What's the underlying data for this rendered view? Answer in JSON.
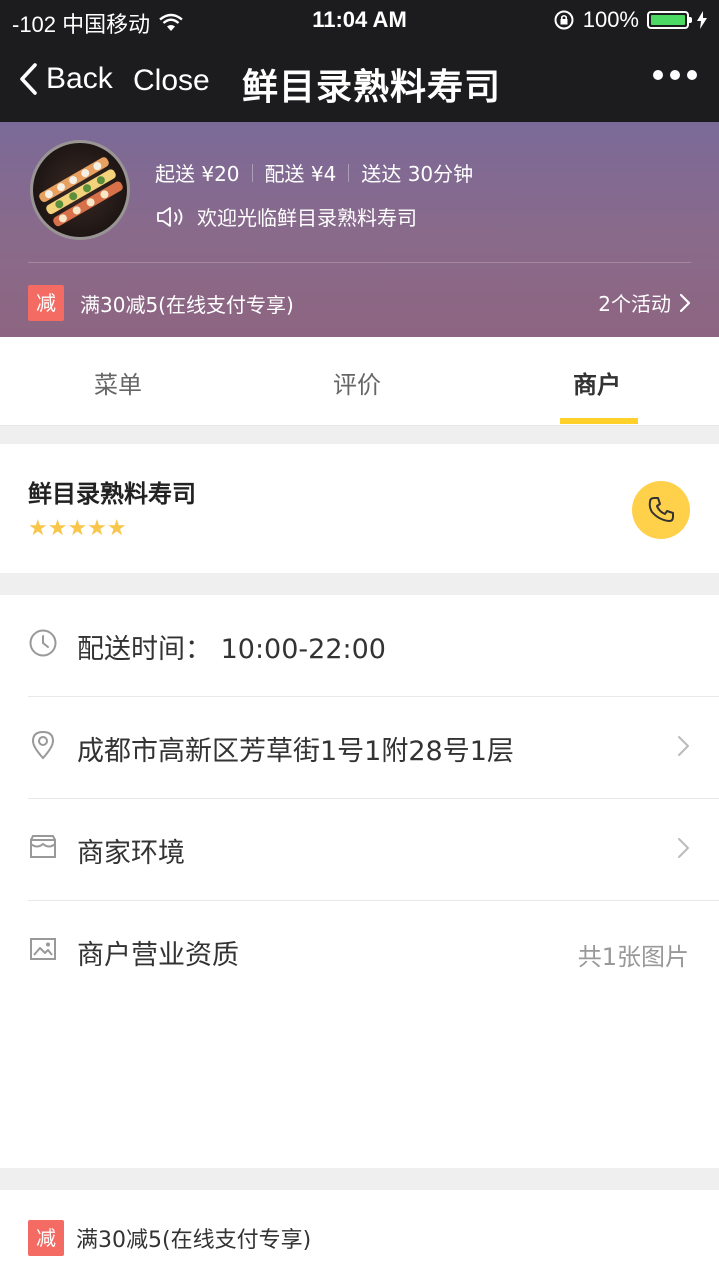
{
  "status_bar": {
    "carrier": "-102 中国移动",
    "time": "11:04 AM",
    "battery": "100%"
  },
  "nav": {
    "back_label": "Back",
    "close_label": "Close",
    "title": "鲜目录熟料寿司"
  },
  "shop_header": {
    "min_order": "起送 ¥20",
    "delivery_fee": "配送 ¥4",
    "delivery_time": "送达 30分钟",
    "notice": "欢迎光临鲜目录熟料寿司",
    "promo_tag": "减",
    "promo_text": "满30减5(在线支付专享)",
    "activity_count": "2个活动"
  },
  "tabs": [
    {
      "label": "菜单"
    },
    {
      "label": "评价"
    },
    {
      "label": "商户"
    }
  ],
  "merchant": {
    "name": "鲜目录熟料寿司",
    "rating": 5,
    "stars": "★★★★★"
  },
  "info_rows": {
    "hours": "配送时间： 10:00-22:00",
    "address": "成都市高新区芳草街1号1附28号1层",
    "environment": "商家环境",
    "license": "商户营业资质",
    "license_count": "共1张图片"
  },
  "bottom_promo": {
    "tag": "减",
    "text": "满30减5(在线支付专享)"
  },
  "colors": {
    "accent": "#ffd12a",
    "promo_tag": "#f36b63",
    "star": "#f8c64a",
    "nav_bg": "#1c1c1e"
  }
}
